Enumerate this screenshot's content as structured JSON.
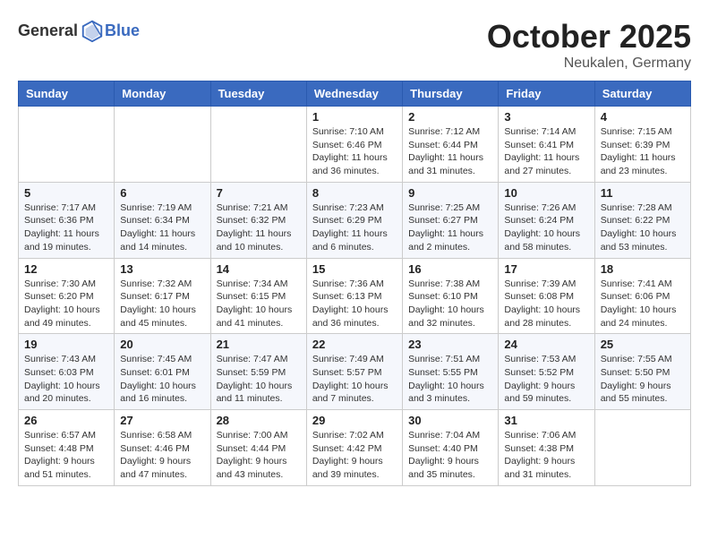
{
  "header": {
    "logo_general": "General",
    "logo_blue": "Blue",
    "month": "October 2025",
    "location": "Neukalen, Germany"
  },
  "weekdays": [
    "Sunday",
    "Monday",
    "Tuesday",
    "Wednesday",
    "Thursday",
    "Friday",
    "Saturday"
  ],
  "weeks": [
    [
      {
        "day": "",
        "info": ""
      },
      {
        "day": "",
        "info": ""
      },
      {
        "day": "",
        "info": ""
      },
      {
        "day": "1",
        "info": "Sunrise: 7:10 AM\nSunset: 6:46 PM\nDaylight: 11 hours\nand 36 minutes."
      },
      {
        "day": "2",
        "info": "Sunrise: 7:12 AM\nSunset: 6:44 PM\nDaylight: 11 hours\nand 31 minutes."
      },
      {
        "day": "3",
        "info": "Sunrise: 7:14 AM\nSunset: 6:41 PM\nDaylight: 11 hours\nand 27 minutes."
      },
      {
        "day": "4",
        "info": "Sunrise: 7:15 AM\nSunset: 6:39 PM\nDaylight: 11 hours\nand 23 minutes."
      }
    ],
    [
      {
        "day": "5",
        "info": "Sunrise: 7:17 AM\nSunset: 6:36 PM\nDaylight: 11 hours\nand 19 minutes."
      },
      {
        "day": "6",
        "info": "Sunrise: 7:19 AM\nSunset: 6:34 PM\nDaylight: 11 hours\nand 14 minutes."
      },
      {
        "day": "7",
        "info": "Sunrise: 7:21 AM\nSunset: 6:32 PM\nDaylight: 11 hours\nand 10 minutes."
      },
      {
        "day": "8",
        "info": "Sunrise: 7:23 AM\nSunset: 6:29 PM\nDaylight: 11 hours\nand 6 minutes."
      },
      {
        "day": "9",
        "info": "Sunrise: 7:25 AM\nSunset: 6:27 PM\nDaylight: 11 hours\nand 2 minutes."
      },
      {
        "day": "10",
        "info": "Sunrise: 7:26 AM\nSunset: 6:24 PM\nDaylight: 10 hours\nand 58 minutes."
      },
      {
        "day": "11",
        "info": "Sunrise: 7:28 AM\nSunset: 6:22 PM\nDaylight: 10 hours\nand 53 minutes."
      }
    ],
    [
      {
        "day": "12",
        "info": "Sunrise: 7:30 AM\nSunset: 6:20 PM\nDaylight: 10 hours\nand 49 minutes."
      },
      {
        "day": "13",
        "info": "Sunrise: 7:32 AM\nSunset: 6:17 PM\nDaylight: 10 hours\nand 45 minutes."
      },
      {
        "day": "14",
        "info": "Sunrise: 7:34 AM\nSunset: 6:15 PM\nDaylight: 10 hours\nand 41 minutes."
      },
      {
        "day": "15",
        "info": "Sunrise: 7:36 AM\nSunset: 6:13 PM\nDaylight: 10 hours\nand 36 minutes."
      },
      {
        "day": "16",
        "info": "Sunrise: 7:38 AM\nSunset: 6:10 PM\nDaylight: 10 hours\nand 32 minutes."
      },
      {
        "day": "17",
        "info": "Sunrise: 7:39 AM\nSunset: 6:08 PM\nDaylight: 10 hours\nand 28 minutes."
      },
      {
        "day": "18",
        "info": "Sunrise: 7:41 AM\nSunset: 6:06 PM\nDaylight: 10 hours\nand 24 minutes."
      }
    ],
    [
      {
        "day": "19",
        "info": "Sunrise: 7:43 AM\nSunset: 6:03 PM\nDaylight: 10 hours\nand 20 minutes."
      },
      {
        "day": "20",
        "info": "Sunrise: 7:45 AM\nSunset: 6:01 PM\nDaylight: 10 hours\nand 16 minutes."
      },
      {
        "day": "21",
        "info": "Sunrise: 7:47 AM\nSunset: 5:59 PM\nDaylight: 10 hours\nand 11 minutes."
      },
      {
        "day": "22",
        "info": "Sunrise: 7:49 AM\nSunset: 5:57 PM\nDaylight: 10 hours\nand 7 minutes."
      },
      {
        "day": "23",
        "info": "Sunrise: 7:51 AM\nSunset: 5:55 PM\nDaylight: 10 hours\nand 3 minutes."
      },
      {
        "day": "24",
        "info": "Sunrise: 7:53 AM\nSunset: 5:52 PM\nDaylight: 9 hours\nand 59 minutes."
      },
      {
        "day": "25",
        "info": "Sunrise: 7:55 AM\nSunset: 5:50 PM\nDaylight: 9 hours\nand 55 minutes."
      }
    ],
    [
      {
        "day": "26",
        "info": "Sunrise: 6:57 AM\nSunset: 4:48 PM\nDaylight: 9 hours\nand 51 minutes."
      },
      {
        "day": "27",
        "info": "Sunrise: 6:58 AM\nSunset: 4:46 PM\nDaylight: 9 hours\nand 47 minutes."
      },
      {
        "day": "28",
        "info": "Sunrise: 7:00 AM\nSunset: 4:44 PM\nDaylight: 9 hours\nand 43 minutes."
      },
      {
        "day": "29",
        "info": "Sunrise: 7:02 AM\nSunset: 4:42 PM\nDaylight: 9 hours\nand 39 minutes."
      },
      {
        "day": "30",
        "info": "Sunrise: 7:04 AM\nSunset: 4:40 PM\nDaylight: 9 hours\nand 35 minutes."
      },
      {
        "day": "31",
        "info": "Sunrise: 7:06 AM\nSunset: 4:38 PM\nDaylight: 9 hours\nand 31 minutes."
      },
      {
        "day": "",
        "info": ""
      }
    ]
  ]
}
